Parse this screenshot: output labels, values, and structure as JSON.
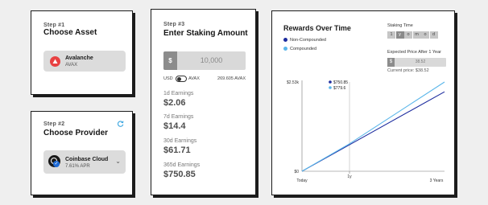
{
  "step1": {
    "step": "Step #1",
    "title": "Choose Asset",
    "asset_name": "Avalanche",
    "asset_ticker": "AVAX"
  },
  "step2": {
    "step": "Step #2",
    "title": "Choose Provider",
    "provider_name": "Coinbase Cloud",
    "provider_apr": "7.61% APR",
    "refresh_icon": "refresh-icon"
  },
  "step3": {
    "step": "Step #3",
    "title": "Enter Staking Amount",
    "currency_symbol": "$",
    "amount_value": "10,000",
    "toggle_left": "USD",
    "toggle_right": "AVAX",
    "conversion": "269.605 AVAX",
    "earnings": [
      {
        "label": "1d Earnings",
        "value": "$2.06"
      },
      {
        "label": "7d Earnings",
        "value": "$14.4"
      },
      {
        "label": "30d Earnings",
        "value": "$61.71"
      },
      {
        "label": "365d Earnings",
        "value": "$750.85"
      }
    ]
  },
  "rewards": {
    "title": "Rewards Over Time",
    "legend_non": "Non-Compounded",
    "legend_comp": "Compounded",
    "staking_time_label": "Staking Time",
    "timeframes": [
      "1",
      "y",
      "o",
      "m",
      "o",
      "d"
    ],
    "selected_timeframe": 1,
    "expected_price_label": "Expected Price After 1 Year",
    "expected_currency": "$",
    "expected_price": "38.52",
    "current_price": "Current price: $38.52"
  },
  "colors": {
    "non_compounded": "#1c2b9e",
    "compounded": "#5ab6ea"
  },
  "chart_data": {
    "type": "line",
    "title": "Rewards Over Time",
    "x_tick_labels": [
      "Today",
      "1y",
      "3 Years"
    ],
    "x": [
      0,
      1,
      3
    ],
    "xlim": [
      0,
      3
    ],
    "y_tick_labels": [
      "$0",
      "$2.53k"
    ],
    "ylim": [
      0,
      2530
    ],
    "ylabel": "",
    "xlabel": "",
    "series": [
      {
        "name": "Non-Compounded",
        "values": [
          0,
          750.85,
          2252.55
        ],
        "marker_label": "$750.85"
      },
      {
        "name": "Compounded",
        "values": [
          0,
          779.6,
          2530
        ],
        "marker_label": "$779.6"
      }
    ],
    "marker_x": 1,
    "grid": false,
    "legend": "top-left"
  }
}
